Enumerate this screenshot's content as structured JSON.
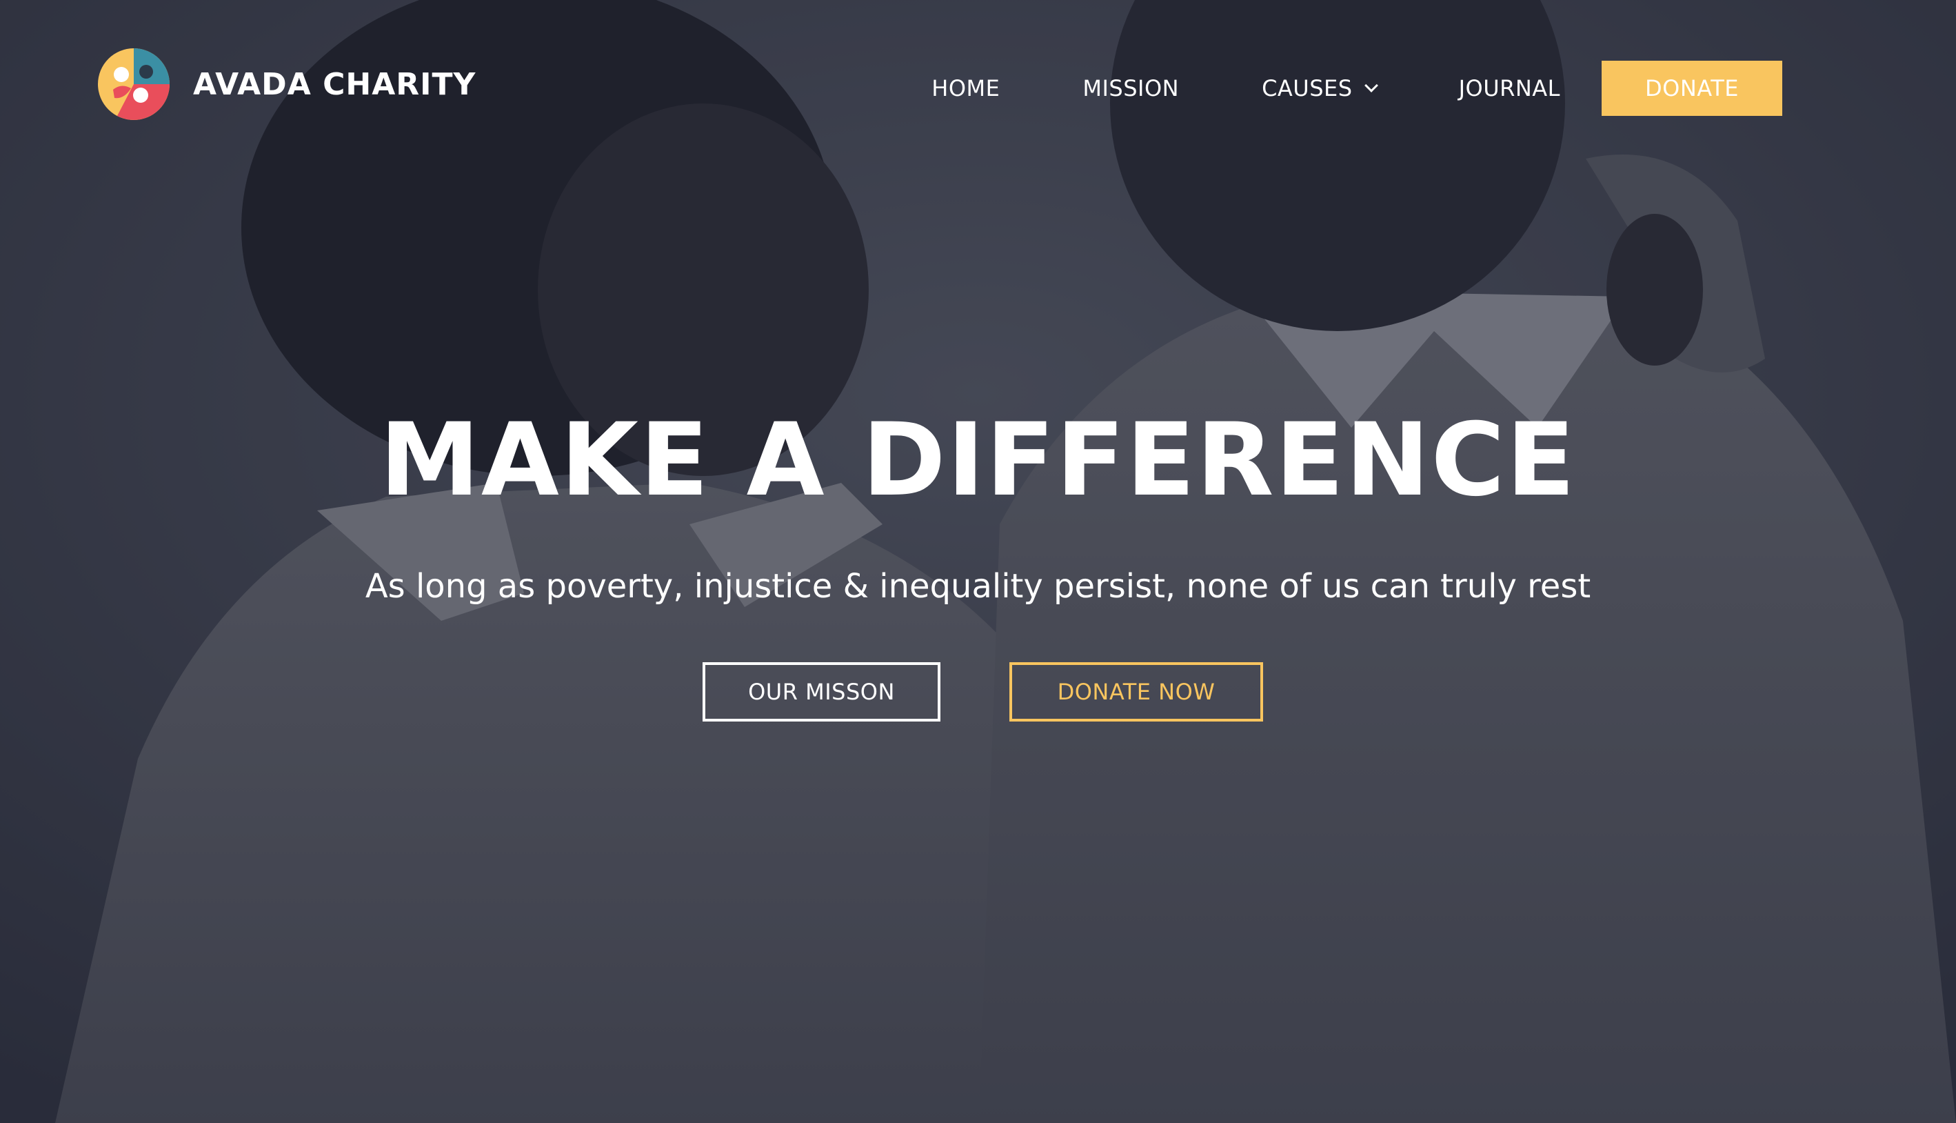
{
  "brand": {
    "name": "AVADA CHARITY",
    "logo_icon": "people-circle-logo-icon",
    "logo_colors": [
      "#f9c55f",
      "#e94e5b",
      "#3b8fa4"
    ]
  },
  "nav": {
    "items": [
      {
        "label": "HOME",
        "has_dropdown": false
      },
      {
        "label": "MISSION",
        "has_dropdown": false
      },
      {
        "label": "CAUSES",
        "has_dropdown": true
      },
      {
        "label": "JOURNAL",
        "has_dropdown": false
      }
    ],
    "donate_label": "DONATE",
    "dropdown_icon": "chevron-down-icon"
  },
  "hero": {
    "headline": "MAKE A DIFFERENCE",
    "subline": "As long as poverty, injustice & inequality persist, none of us can truly rest",
    "primary_cta": "OUR MISSON",
    "secondary_cta": "DONATE NOW"
  },
  "colors": {
    "accent": "#f9c55f",
    "text": "#ffffff",
    "overlay": "#24283a"
  }
}
